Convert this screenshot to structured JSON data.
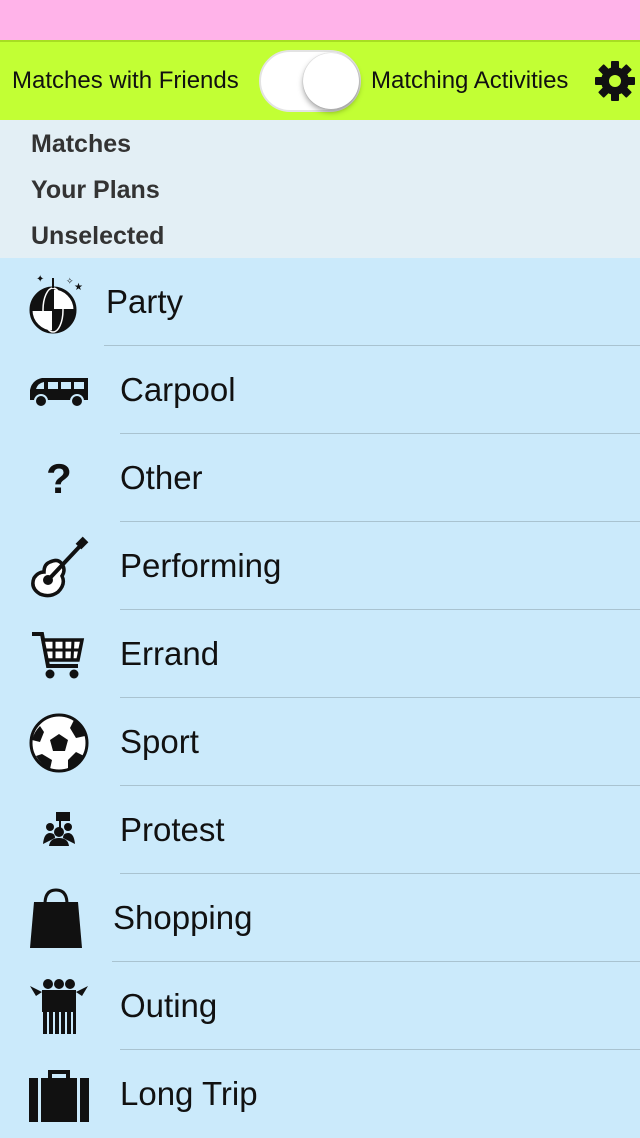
{
  "toolbar": {
    "left_label": "Matches with Friends",
    "right_label": "Matching Activities",
    "toggle_on": true,
    "settings_icon": "gear-icon"
  },
  "sections": {
    "items": [
      "Matches",
      "Your Plans",
      "Unselected"
    ]
  },
  "activities": [
    {
      "label": "Party",
      "icon": "disco-ball-icon"
    },
    {
      "label": "Carpool",
      "icon": "van-icon"
    },
    {
      "label": "Other",
      "icon": "question-mark-icon"
    },
    {
      "label": "Performing",
      "icon": "guitar-icon"
    },
    {
      "label": "Errand",
      "icon": "shopping-cart-icon"
    },
    {
      "label": "Sport",
      "icon": "soccer-ball-icon"
    },
    {
      "label": "Protest",
      "icon": "protest-group-icon"
    },
    {
      "label": "Shopping",
      "icon": "shopping-bag-icon"
    },
    {
      "label": "Outing",
      "icon": "group-people-icon"
    },
    {
      "label": "Long Trip",
      "icon": "suitcase-icon"
    }
  ],
  "colors": {
    "status_bar": "#ffb3e9",
    "toolbar": "#c2ff34",
    "sections_bg": "#e3eff5",
    "list_bg": "#cbeafb"
  }
}
